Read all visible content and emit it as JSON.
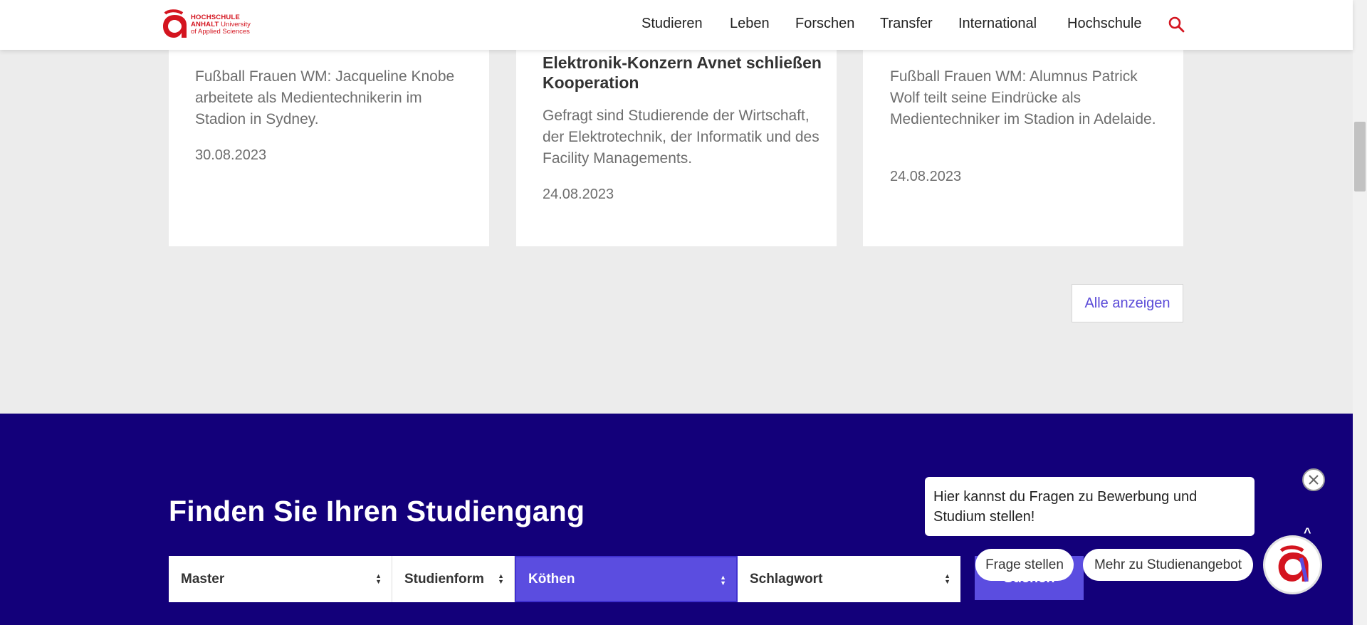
{
  "header": {
    "logo": {
      "line1": "HOCHSCHULE",
      "line2": "ANHALT",
      "line2_rest": " University",
      "line3": "of Applied Sciences"
    },
    "nav": [
      "Studieren",
      "Leben",
      "Forschen",
      "Transfer",
      "International",
      "Hochschule"
    ],
    "search_icon": "search-icon"
  },
  "cards": [
    {
      "title_partial": "",
      "text": "Fußball Frauen WM: Jacqueline Knobe arbeitete als Medientechnikerin im Stadion in Sydney.",
      "date": "30.08.2023"
    },
    {
      "title": "Elektronik-Konzern Avnet schließen Kooperation",
      "text": "Gefragt sind Studierende der Wirtschaft, der Elektrotechnik, der Informatik und des Facility Managements.",
      "date": "24.08.2023"
    },
    {
      "text": "Fußball Frauen WM: Alumnus Patrick Wolf teilt seine Eindrücke als Medientechniker im Stadion in Adelaide.",
      "date": "24.08.2023"
    }
  ],
  "all_button": "Alle anzeigen",
  "finder": {
    "title": "Finden Sie Ihren Studiengang",
    "selects": [
      "Master",
      "Studienform",
      "Köthen",
      "Schlagwort"
    ],
    "search_button": "Suchen"
  },
  "chat": {
    "message": "Hier kannst du Fragen zu Bewerbung und Studium stellen!",
    "chips": [
      "Frage stellen",
      "Mehr zu Studienangebot"
    ]
  },
  "colors": {
    "brand_red": "#d4141f",
    "finder_bg": "#13007a",
    "accent": "#5b4de0"
  }
}
